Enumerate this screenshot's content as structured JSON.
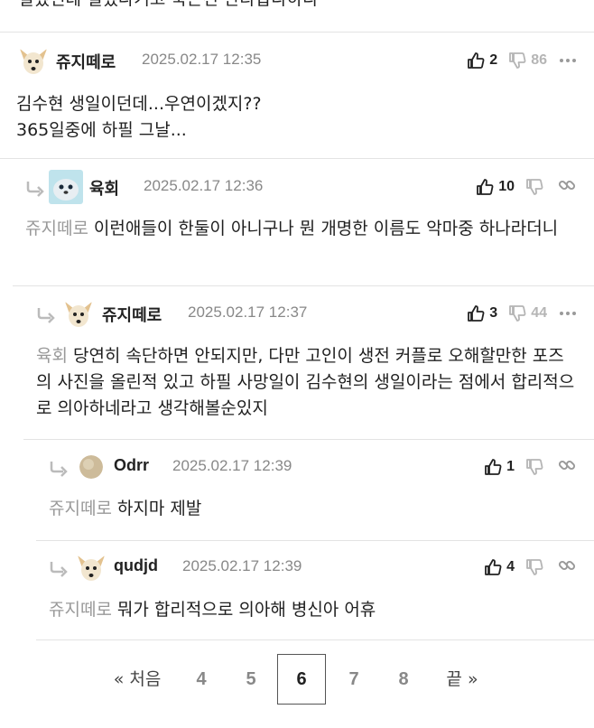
{
  "top_partial_text": "설렜던데 설렜다거고 죽은건 안타깝다하다",
  "icons": {
    "thumb_up": "thumb-up-icon",
    "thumb_down": "thumb-down-icon",
    "more": "more-dots-icon",
    "link": "link-icon",
    "reply": "reply-arrow-icon"
  },
  "colors": {
    "mention": "#999999",
    "muted_count": "#b5b5b5",
    "date": "#888888"
  },
  "comments": [
    {
      "nick": "쥬지떼로",
      "date": "2025.02.17 12:35",
      "likes": "2",
      "dislikes": "86",
      "mention": "",
      "text": "김수현 생일이던데...우연이겠지??\n365일중에 하필 그날..."
    },
    {
      "nick": "육회",
      "date": "2025.02.17 12:36",
      "likes": "10",
      "dislikes": "",
      "mention": "쥬지떼로",
      "text": "이런애들이 한둘이 아니구나 뭔 개명한 이름도 악마중 하나라더니"
    },
    {
      "nick": "쥬지떼로",
      "date": "2025.02.17 12:37",
      "likes": "3",
      "dislikes": "44",
      "mention": "육회",
      "text": "당연히 속단하면 안되지만, 다만 고인이 생전 커플로 오해할만한 포즈의 사진을 올린적 있고 하필 사망일이 김수현의 생일이라는 점에서 합리적으로 의아하네라고 생각해볼순있지"
    },
    {
      "nick": "Odrr",
      "date": "2025.02.17 12:39",
      "likes": "1",
      "dislikes": "",
      "mention": "쥬지떼로",
      "text": "하지마 제발"
    },
    {
      "nick": "qudjd",
      "date": "2025.02.17 12:39",
      "likes": "4",
      "dislikes": "",
      "mention": "쥬지떼로",
      "text": "뭐가 합리적으로 의아해 병신아 어휴"
    }
  ],
  "pagination": {
    "first": "« 처음",
    "pages": [
      "4",
      "5",
      "6",
      "7",
      "8"
    ],
    "current": "6",
    "last": "끝 »"
  }
}
